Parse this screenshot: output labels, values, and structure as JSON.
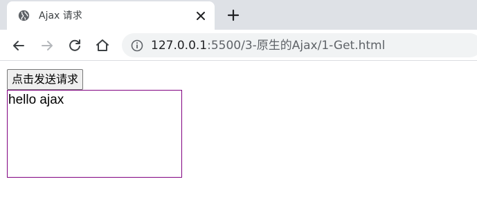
{
  "browser": {
    "tab": {
      "title": "Ajax 请求",
      "favicon": "globe-icon"
    },
    "address_bar": {
      "host": "127.0.0.1",
      "path": ":5500/3-原生的Ajax/1-Get.html"
    },
    "icons": {
      "back": "arrow-left-icon",
      "forward": "arrow-right-icon",
      "reload": "reload-icon",
      "home": "home-icon",
      "site_info": "info-icon",
      "close_tab": "close-icon",
      "new_tab": "plus-icon"
    }
  },
  "page": {
    "button_label": "点击发送请求",
    "result_text": "hello ajax"
  },
  "colors": {
    "tabstrip": "#dee1e6",
    "omnibox": "#f1f3f4",
    "result_border": "#800080"
  }
}
